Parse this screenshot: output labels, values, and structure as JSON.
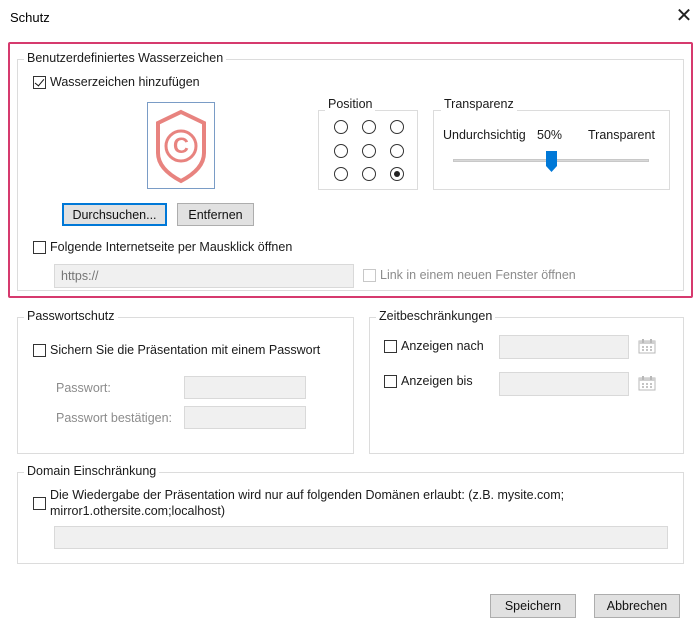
{
  "window": {
    "title": "Schutz",
    "close_symbol": "✕"
  },
  "watermark": {
    "group_label": "Benutzerdefiniertes Wasserzeichen",
    "add_checkbox_label": "Wasserzeichen hinzufügen",
    "add_checked": true,
    "preview_symbol": "©",
    "position_label": "Position",
    "position_selected_index": 8,
    "transparency_label": "Transparenz",
    "opaque_label": "Undurchsichtig",
    "value_label": "50%",
    "transparency_value": 0.5,
    "transparent_label": "Transparent",
    "browse_button": "Durchsuchen...",
    "remove_button": "Entfernen",
    "link_checkbox_label": "Folgende Internetseite per Mausklick öffnen",
    "url_placeholder": "https://",
    "new_window_label": "Link in einem neuen Fenster öffnen"
  },
  "password": {
    "group_label": "Passwortschutz",
    "checkbox_label": "Sichern Sie die Präsentation mit einem Passwort",
    "password_label": "Passwort:",
    "confirm_label": "Passwort bestätigen:"
  },
  "time": {
    "group_label": "Zeitbeschränkungen",
    "show_after_label": "Anzeigen nach",
    "show_until_label": "Anzeigen bis"
  },
  "domain": {
    "group_label": "Domain Einschränkung",
    "checkbox_label_line1": "Die Wiedergabe der Präsentation wird nur auf folgenden Domänen erlaubt: (z.B. mysite.com;",
    "checkbox_label_line2": "mirror1.othersite.com;localhost)"
  },
  "buttons": {
    "save": "Speichern",
    "cancel": "Abbrechen"
  },
  "colors": {
    "highlight": "#d63a6e",
    "accent": "#0078d7",
    "watermark_icon": "#e8837f"
  }
}
